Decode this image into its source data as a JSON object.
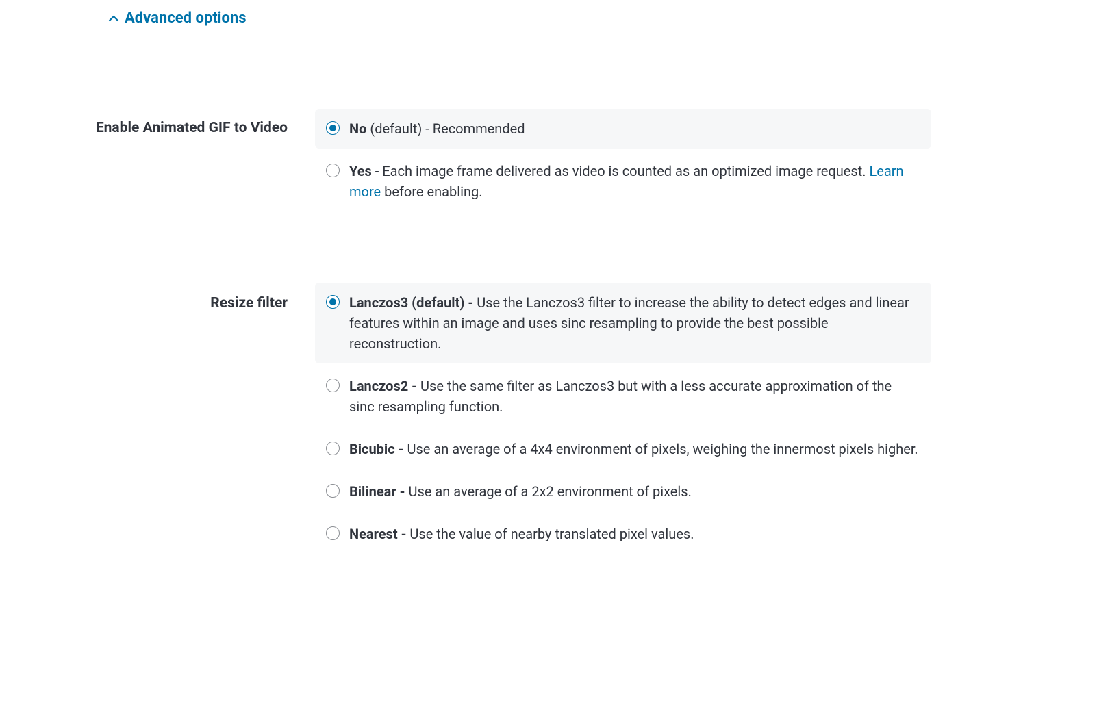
{
  "advanced": {
    "label": "Advanced options"
  },
  "gif": {
    "label": "Enable Animated GIF to Video",
    "no": {
      "bold": "No",
      "suffix": " (default)",
      "dash": " - ",
      "desc": "Recommended"
    },
    "yes": {
      "bold": "Yes",
      "dash": " - ",
      "desc_before": "Each image frame delivered as video is counted as an optimized image request. ",
      "link": "Learn more",
      "desc_after": " before enabling."
    }
  },
  "resize": {
    "label": "Resize filter",
    "lanczos3": {
      "bold": "Lanczos3 (default) - ",
      "desc": "Use the Lanczos3 filter to increase the ability to detect edges and linear features within an image and uses sinc resampling to provide the best possible reconstruction."
    },
    "lanczos2": {
      "bold": "Lanczos2 - ",
      "desc": "Use the same filter as Lanczos3 but with a less accurate approximation of the sinc resampling function."
    },
    "bicubic": {
      "bold": "Bicubic - ",
      "desc": "Use an average of a 4x4 environment of pixels, weighing the innermost pixels higher."
    },
    "bilinear": {
      "bold": "Bilinear - ",
      "desc": "Use an average of a 2x2 environment of pixels."
    },
    "nearest": {
      "bold": "Nearest - ",
      "desc": "Use the value of nearby translated pixel values."
    }
  }
}
